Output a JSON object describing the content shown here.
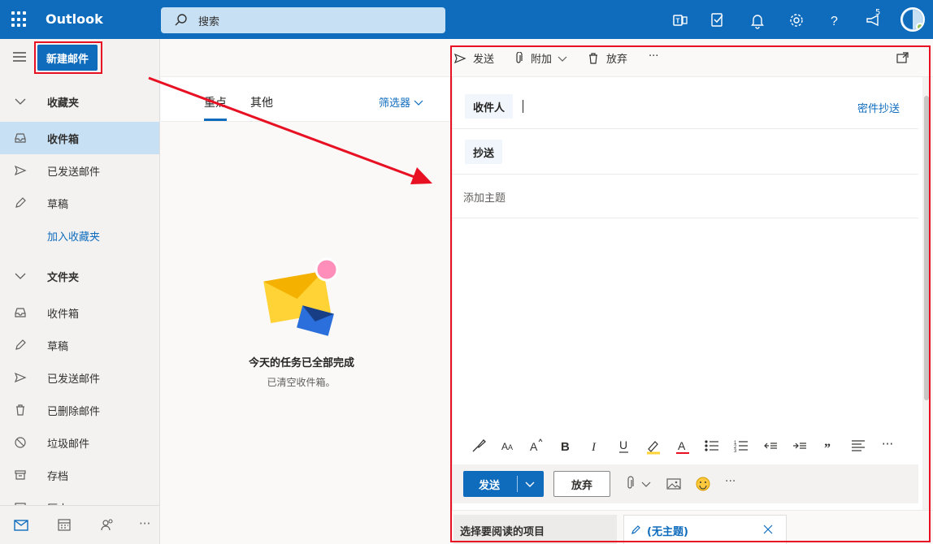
{
  "app": {
    "brand": "Outlook"
  },
  "search": {
    "placeholder": "搜索"
  },
  "header": {
    "notification_count": "5"
  },
  "new_mail": {
    "label": "新建邮件"
  },
  "nav": {
    "favorites_header": "收藏夹",
    "favorites": [
      {
        "label": "收件箱",
        "icon": "inbox-icon"
      },
      {
        "label": "已发送邮件",
        "icon": "send-icon"
      },
      {
        "label": "草稿",
        "icon": "pencil-icon"
      }
    ],
    "add_favorite": "加入收藏夹",
    "folders_header": "文件夹",
    "folders": [
      {
        "label": "收件箱",
        "icon": "inbox-icon"
      },
      {
        "label": "草稿",
        "icon": "pencil-icon"
      },
      {
        "label": "已发送邮件",
        "icon": "send-icon"
      },
      {
        "label": "已删除邮件",
        "icon": "trash-icon"
      },
      {
        "label": "垃圾邮件",
        "icon": "block-icon"
      },
      {
        "label": "存档",
        "icon": "archive-icon"
      },
      {
        "label": "历史",
        "icon": "history-icon"
      }
    ]
  },
  "message_list": {
    "tab_focused": "重点",
    "tab_other": "其他",
    "filter_label": "筛选器",
    "empty_title": "今天的任务已全部完成",
    "empty_subtitle": "已清空收件箱。"
  },
  "command_bar": {
    "send": "发送",
    "attach": "附加",
    "discard": "放弃",
    "more": "···"
  },
  "compose": {
    "to_label": "收件人",
    "cc_label": "抄送",
    "bcc_link": "密件抄送",
    "subject_placeholder": "添加主题",
    "send_button": "发送",
    "discard_button": "放弃",
    "more": "···"
  },
  "bottom_tabs": {
    "reading_tab": "选择要阅读的项目",
    "draft_tab": "(无主题)"
  },
  "colors": {
    "accent": "#0f6cbd",
    "highlight": "#e81123"
  }
}
